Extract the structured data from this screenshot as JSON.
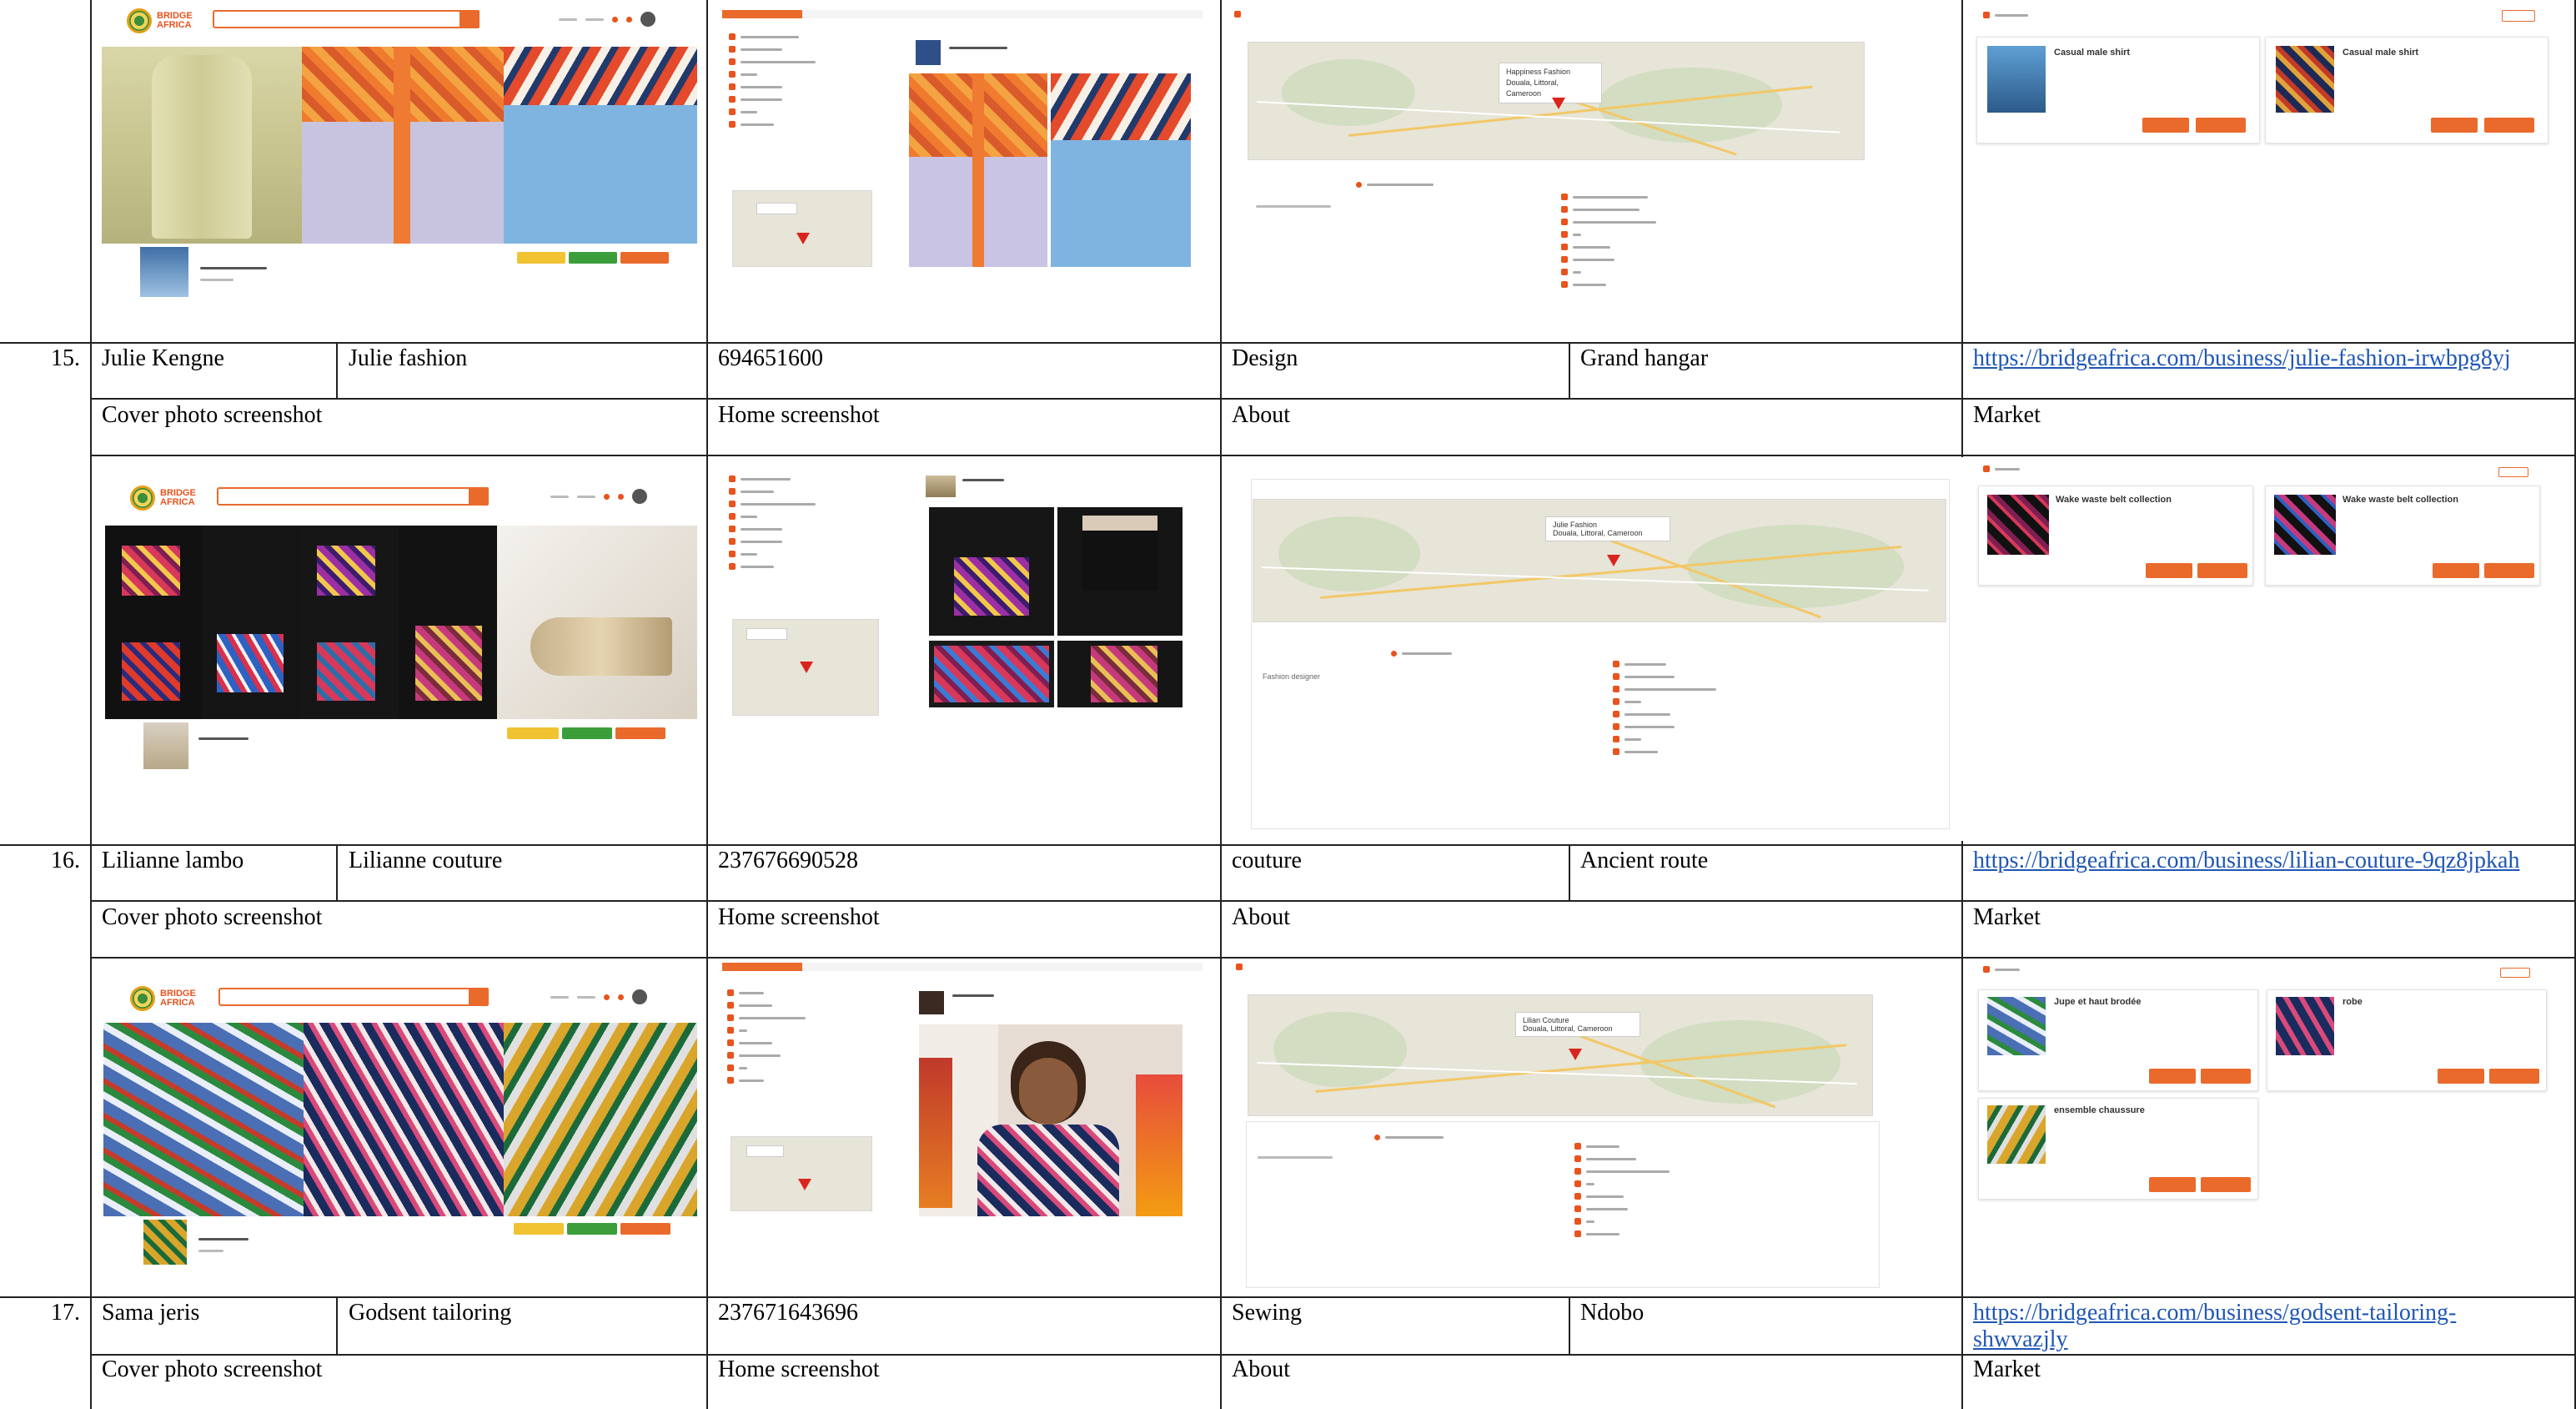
{
  "rows": [
    {
      "number": "15.",
      "owner": "Julie Kengne",
      "business": "Julie fashion",
      "phone": "694651600",
      "category": "Design",
      "location": "Grand hangar",
      "url": "https://bridgeafrica.com/business/julie-fashion-irwbpg8yj"
    },
    {
      "number": "16.",
      "owner": "Lilianne lambo",
      "business": "Lilianne couture",
      "phone": "237676690528",
      "category": "couture",
      "location": "Ancient route",
      "url": "https://bridgeafrica.com/business/lilian-couture-9qz8jpkah"
    },
    {
      "number": "17.",
      "owner": "Sama jeris",
      "business": "Godsent tailoring",
      "phone": "237671643696",
      "category": "Sewing",
      "location": "Ndobo",
      "url_line1": "https://bridgeafrica.com/business/godsent-tailoring-",
      "url_line2": "shwvazjly"
    }
  ],
  "section_labels": {
    "cover": "Cover photo screenshot",
    "home": "Home screenshot",
    "about": "About",
    "market": "Market"
  },
  "screens": {
    "top": {
      "map_card": "Happiness Fashion\nDouala, Littoral, Cameroon",
      "market_items": [
        "Casual male shirt",
        "Casual male shirt"
      ]
    },
    "julie": {
      "map_card_line1": "Julie Fashion",
      "map_card_line2": "Douala, Littoral, Cameroon",
      "about_subtitle": "Fashion designer",
      "market_items": [
        "Wake waste belt collection",
        "Wake waste belt collection"
      ]
    },
    "lilianne": {
      "map_card_line1": "Lilian Couture",
      "map_card_line2": "Douala, Littoral, Cameroon",
      "market_items": [
        "Jupe et haut brodée",
        "robe",
        "ensemble chaussure"
      ]
    }
  },
  "colors": {
    "brand_orange": "#ea6a2c",
    "link_blue": "#1f57b5",
    "pin_red": "#d9251d"
  }
}
